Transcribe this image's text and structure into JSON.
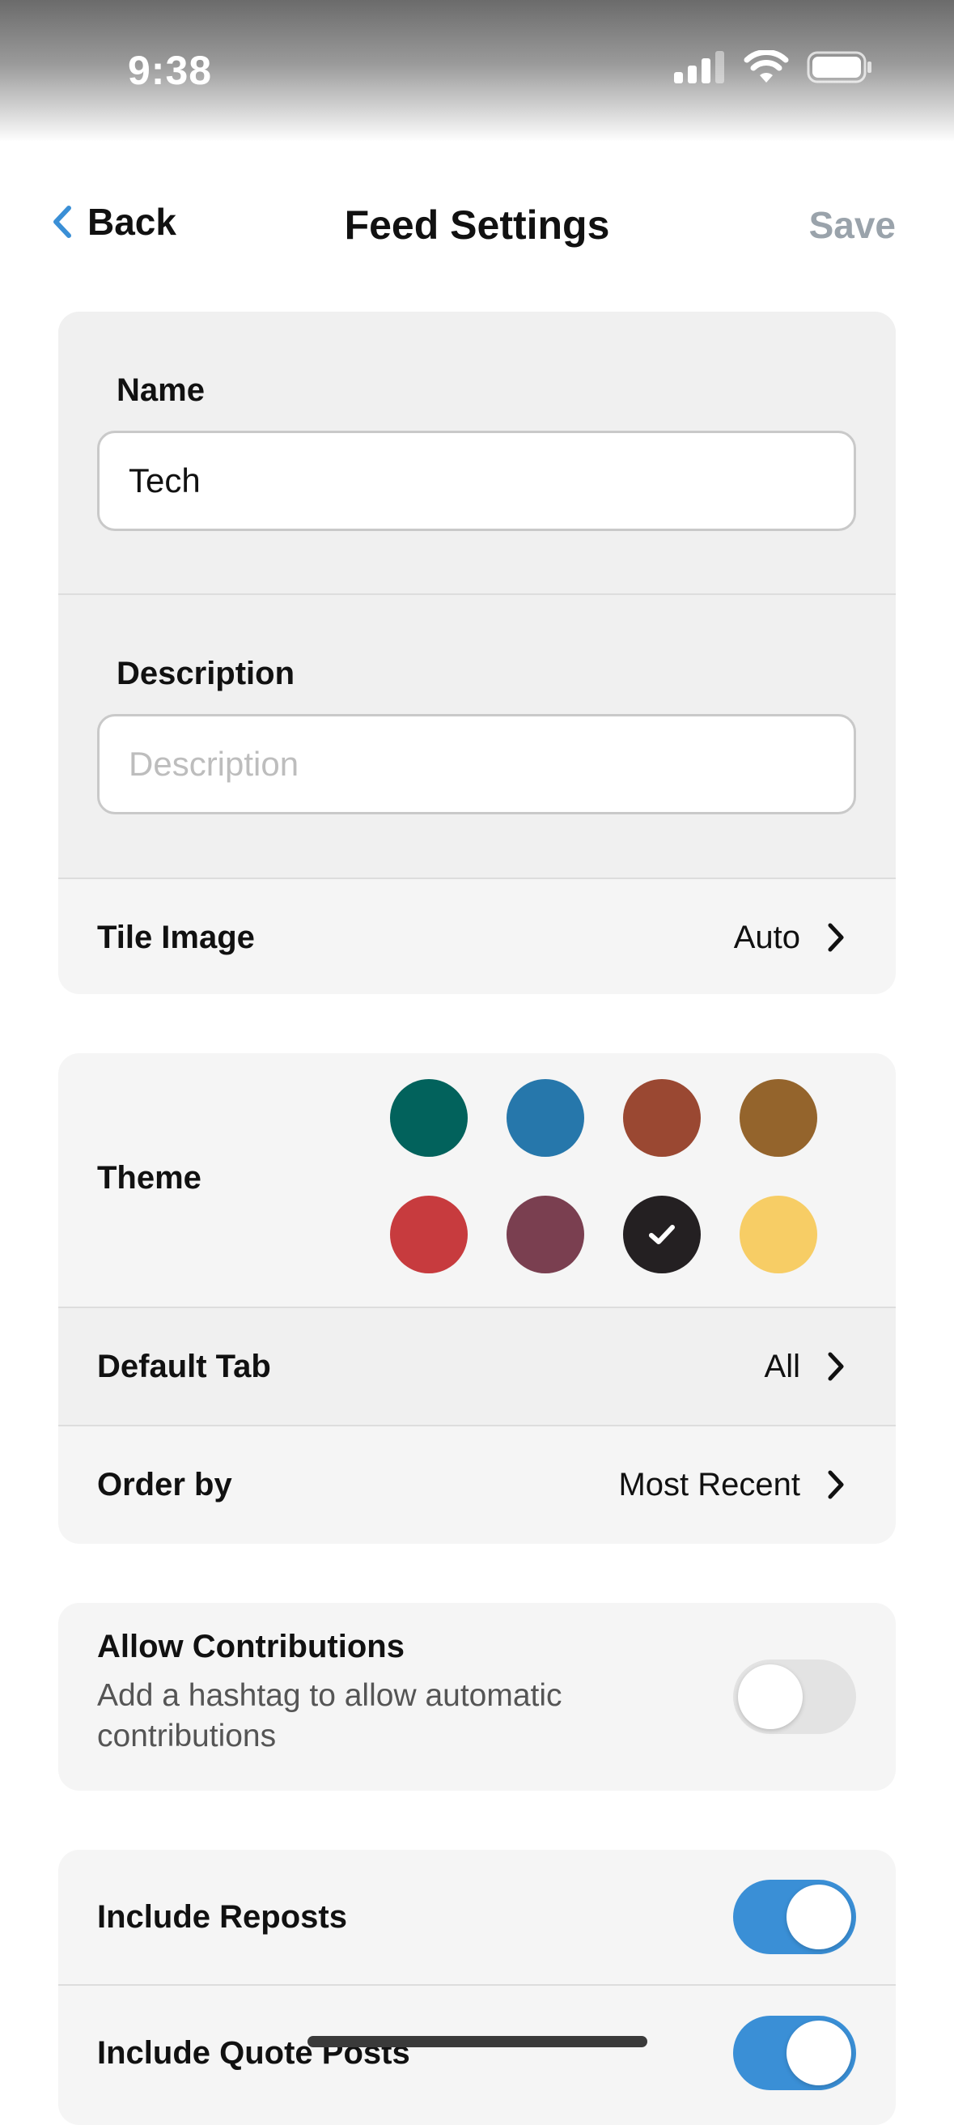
{
  "status_bar": {
    "time": "9:38"
  },
  "nav": {
    "back_label": "Back",
    "title": "Feed Settings",
    "save_label": "Save"
  },
  "name_field": {
    "label": "Name",
    "value": "Tech"
  },
  "description_field": {
    "label": "Description",
    "value": "",
    "placeholder": "Description"
  },
  "tile_image": {
    "label": "Tile Image",
    "value": "Auto"
  },
  "theme": {
    "label": "Theme",
    "swatches": [
      {
        "color": "#02625c",
        "selected": false
      },
      {
        "color": "#2677ab",
        "selected": false
      },
      {
        "color": "#9a4832",
        "selected": false
      },
      {
        "color": "#94642c",
        "selected": false
      },
      {
        "color": "#c73b3e",
        "selected": false
      },
      {
        "color": "#7a3f50",
        "selected": false
      },
      {
        "color": "#242022",
        "selected": true
      },
      {
        "color": "#f7cd65",
        "selected": false
      }
    ]
  },
  "default_tab": {
    "label": "Default Tab",
    "value": "All"
  },
  "order_by": {
    "label": "Order by",
    "value": "Most Recent"
  },
  "allow_contributions": {
    "label": "Allow Contributions",
    "description": "Add a hashtag to allow automatic contributions",
    "enabled": false
  },
  "include_reposts": {
    "label": "Include Reposts",
    "enabled": true
  },
  "include_quote_posts": {
    "label": "Include Quote Posts",
    "enabled": true
  },
  "colors": {
    "accent": "#3a8fd6",
    "save_disabled": "#9aa3ab",
    "back_chevron": "#3a8fd6"
  }
}
